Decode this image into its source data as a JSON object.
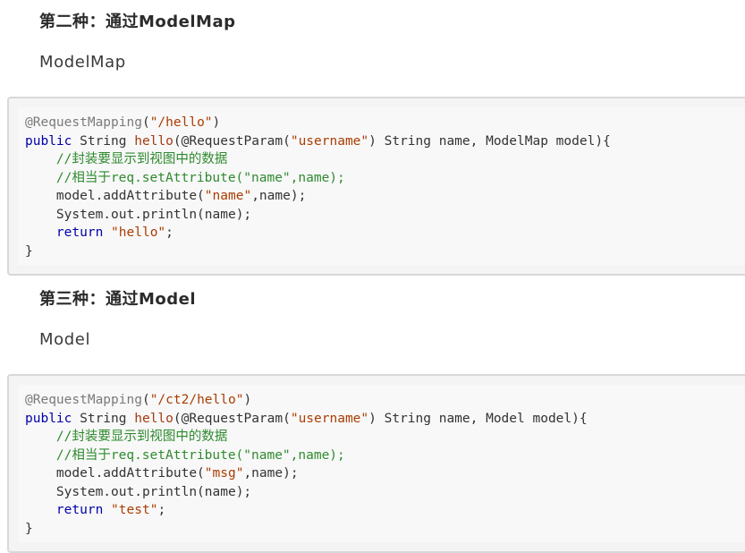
{
  "section2": {
    "heading": "第二种：通过ModelMap",
    "subtext": "ModelMap",
    "code": {
      "line1": {
        "annotation": "@RequestMapping",
        "open": "(",
        "path": "\"/hello\"",
        "close": ")"
      },
      "line2": {
        "kw_public": "public",
        "type": " String ",
        "method": "hello",
        "params_a": "(@RequestParam(",
        "param_name": "\"username\"",
        "params_b": ") String name, ModelMap model){"
      },
      "line3": {
        "comment": "    //封装要显示到视图中的数据"
      },
      "line4": {
        "comment": "    //相当于req.setAttribute(\"name\",name);"
      },
      "line5": {
        "pre": "    model.addAttribute(",
        "key": "\"name\"",
        "post": ",name);"
      },
      "line6": {
        "text": "    System.out.println(name);"
      },
      "line7": {
        "indent": "    ",
        "kw_return": "return",
        "space": " ",
        "value": "\"hello\"",
        "end": ";"
      },
      "line8": {
        "text": "}"
      }
    }
  },
  "section3": {
    "heading": "第三种：通过Model",
    "subtext": "Model",
    "code": {
      "line1": {
        "annotation": "@RequestMapping",
        "open": "(",
        "path": "\"/ct2/hello\"",
        "close": ")"
      },
      "line2": {
        "kw_public": "public",
        "type": " String ",
        "method": "hello",
        "params_a": "(@RequestParam(",
        "param_name": "\"username\"",
        "params_b": ") String name, Model model){"
      },
      "line3": {
        "comment": "    //封装要显示到视图中的数据"
      },
      "line4": {
        "comment": "    //相当于req.setAttribute(\"name\",name);"
      },
      "line5": {
        "pre": "    model.addAttribute(",
        "key": "\"msg\"",
        "post": ",name);"
      },
      "line6": {
        "text": "    System.out.println(name);"
      },
      "line7": {
        "indent": "    ",
        "kw_return": "return",
        "space": " ",
        "value": "\"test\"",
        "end": ";"
      },
      "line8": {
        "text": "}"
      }
    }
  }
}
